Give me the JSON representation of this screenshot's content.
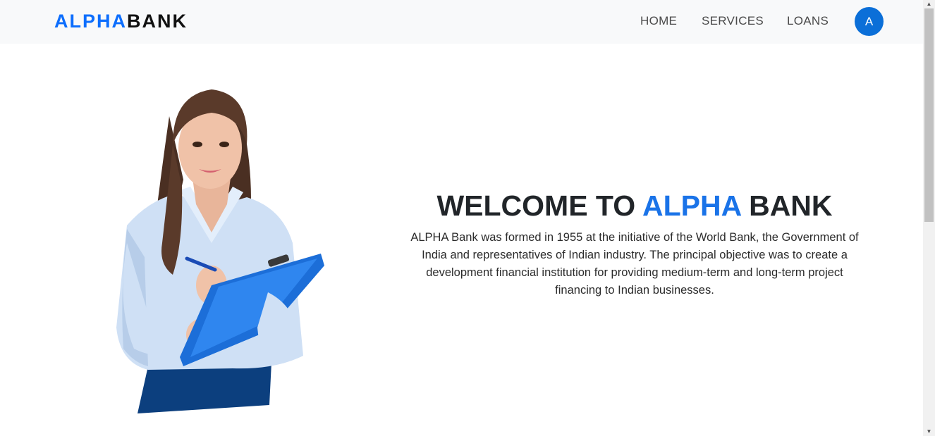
{
  "brand": {
    "part1": "ALPHA",
    "part2": "BANK"
  },
  "nav": {
    "items": [
      {
        "label": "HOME"
      },
      {
        "label": "SERVICES"
      },
      {
        "label": "LOANS"
      }
    ],
    "avatar_letter": "A"
  },
  "hero": {
    "title_pre": "WELCOME TO ",
    "title_accent": "ALPHA",
    "title_post": " BANK",
    "description": "ALPHA Bank was formed in 1955 at the initiative of the World Bank, the Government of India and representatives of Indian industry. The principal objective was to create a development financial institution for providing medium-term and long-term project financing to Indian businesses."
  },
  "colors": {
    "brand_blue": "#0d6efd",
    "accent_blue": "#1a73e8",
    "avatar_blue": "#0b6fd8",
    "navbar_bg": "#f8f9fa"
  },
  "icons": {
    "scroll_up": "▲",
    "scroll_down": "▼"
  }
}
